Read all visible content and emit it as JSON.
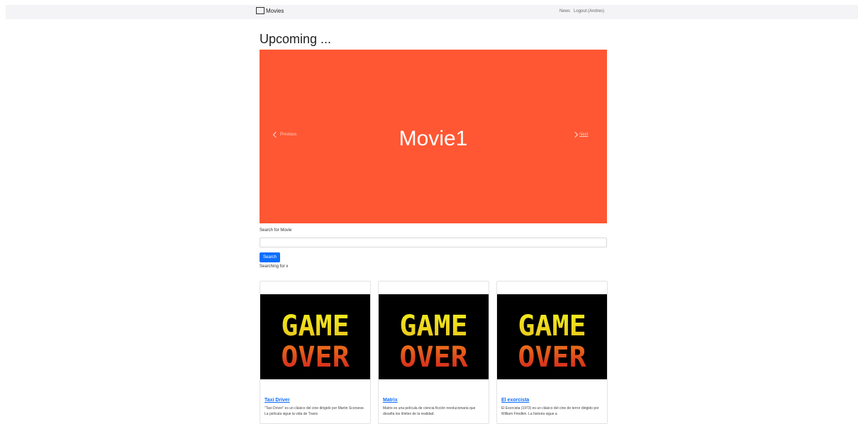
{
  "navbar": {
    "brand": "Movies",
    "links": [
      "News",
      "Logout (Andres)"
    ]
  },
  "page": {
    "title": "Upcoming ..."
  },
  "carousel": {
    "slide_title": "Movie1",
    "prev_label": "Previous",
    "next_label": "Next",
    "background": "#ff5733"
  },
  "search": {
    "label": "Search for Movie",
    "value": "",
    "button_label": "Search",
    "status": "Searching for x"
  },
  "movies": [
    {
      "poster_text": [
        "GAME",
        "OVER"
      ],
      "title": "Taxi Driver",
      "description": "\"Taxi Driver\" es un clásico del cine dirigido por Martin Scorsese. La película sigue la vida de Travis"
    },
    {
      "poster_text": [
        "GAME",
        "OVER"
      ],
      "title": "Matrix",
      "description": "Matrix es una película de ciencia ficción revolucionaria que desafía los límites de la realidad."
    },
    {
      "poster_text": [
        "GAME",
        "OVER"
      ],
      "title": "El exorcista",
      "description": "El Exorcista (1973) es un clásico del cine de terror dirigido por William Friedkin. La historia sigue a"
    }
  ],
  "colors": {
    "accent": "#0d6efd",
    "navbar_bg": "#f4f4f6"
  }
}
